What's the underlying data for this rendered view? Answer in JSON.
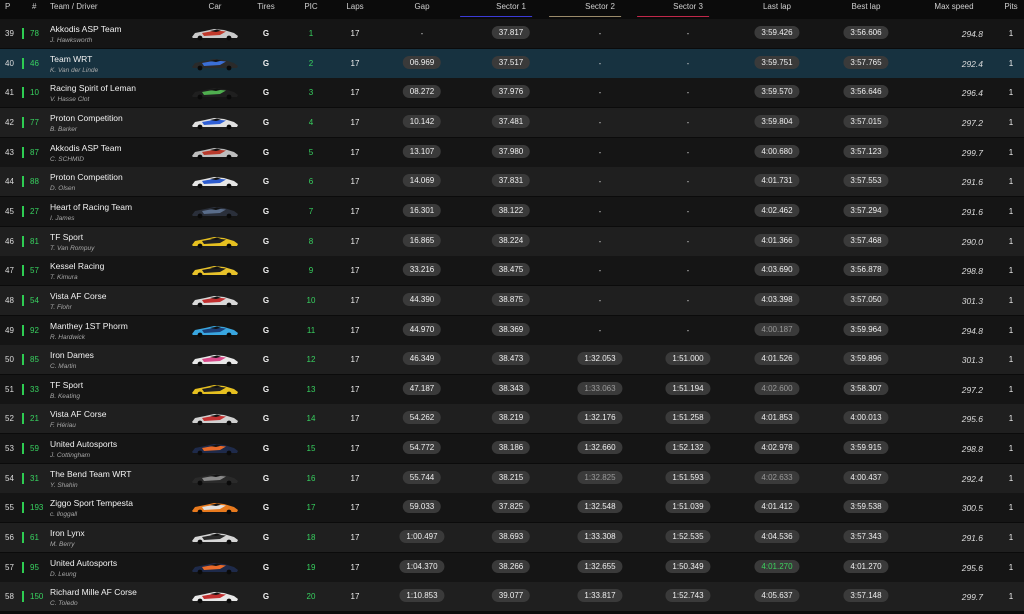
{
  "header": {
    "p": "P",
    "num": "#",
    "team_driver": "Team / Driver",
    "car": "Car",
    "tires": "Tires",
    "pic": "PIC",
    "laps": "Laps",
    "gap": "Gap",
    "sector1": "Sector 1",
    "sector2": "Sector 2",
    "sector3": "Sector 3",
    "last_lap": "Last lap",
    "best_lap": "Best lap",
    "max_speed": "Max speed",
    "pits": "Pits"
  },
  "colors": {
    "sector1": "#3b3bd6",
    "sector2": "#9a8a6a",
    "sector3": "#c0284a",
    "accent_green": "#38d260",
    "highlight_row": "#173240"
  },
  "rows": [
    {
      "p": "39",
      "num": "78",
      "team": "Akkodis ASP Team",
      "driver": "J. Hawksworth",
      "car_colors": [
        "#c9c9c9",
        "#c0392b"
      ],
      "tires": "G",
      "pic": "1",
      "laps": "17",
      "gap": "-",
      "s1": "37.817",
      "s2": "-",
      "s3": "-",
      "last": "3:59.426",
      "best": "3:56.606",
      "speed": "294.8",
      "pits": "1",
      "last_style": "",
      "s2_style": ""
    },
    {
      "p": "40",
      "num": "46",
      "team": "Team WRT",
      "driver": "K. Van der Linde",
      "car_colors": [
        "#2a2a2a",
        "#3b6fd6"
      ],
      "tires": "G",
      "pic": "2",
      "laps": "17",
      "gap": "06.969",
      "s1": "37.517",
      "s2": "-",
      "s3": "-",
      "last": "3:59.751",
      "best": "3:57.765",
      "speed": "292.4",
      "pits": "1",
      "last_style": "",
      "s2_style": ""
    },
    {
      "p": "41",
      "num": "10",
      "team": "Racing Spirit of Leman",
      "driver": "V. Hasse Clot",
      "car_colors": [
        "#1f1f1f",
        "#4fae4f"
      ],
      "tires": "G",
      "pic": "3",
      "laps": "17",
      "gap": "08.272",
      "s1": "37.976",
      "s2": "-",
      "s3": "-",
      "last": "3:59.570",
      "best": "3:56.646",
      "speed": "296.4",
      "pits": "1",
      "last_style": "",
      "s2_style": ""
    },
    {
      "p": "42",
      "num": "77",
      "team": "Proton Competition",
      "driver": "B. Barker",
      "car_colors": [
        "#e0e0e0",
        "#2f5fd6"
      ],
      "tires": "G",
      "pic": "4",
      "laps": "17",
      "gap": "10.142",
      "s1": "37.481",
      "s2": "-",
      "s3": "-",
      "last": "3:59.804",
      "best": "3:57.015",
      "speed": "297.2",
      "pits": "1",
      "last_style": "",
      "s2_style": ""
    },
    {
      "p": "43",
      "num": "87",
      "team": "Akkodis ASP Team",
      "driver": "C. SCHMID",
      "car_colors": [
        "#bdbdbd",
        "#b83a2c"
      ],
      "tires": "G",
      "pic": "5",
      "laps": "17",
      "gap": "13.107",
      "s1": "37.980",
      "s2": "-",
      "s3": "-",
      "last": "4:00.680",
      "best": "3:57.123",
      "speed": "299.7",
      "pits": "1",
      "last_style": "",
      "s2_style": ""
    },
    {
      "p": "44",
      "num": "88",
      "team": "Proton Competition",
      "driver": "D. Olsen",
      "car_colors": [
        "#e6e6e6",
        "#2d5ccf"
      ],
      "tires": "G",
      "pic": "6",
      "laps": "17",
      "gap": "14.069",
      "s1": "37.831",
      "s2": "-",
      "s3": "-",
      "last": "4:01.731",
      "best": "3:57.553",
      "speed": "291.6",
      "pits": "1",
      "last_style": "",
      "s2_style": ""
    },
    {
      "p": "45",
      "num": "27",
      "team": "Heart of Racing Team",
      "driver": "I. James",
      "car_colors": [
        "#2a2f3a",
        "#5a6d8a"
      ],
      "tires": "G",
      "pic": "7",
      "laps": "17",
      "gap": "16.301",
      "s1": "38.122",
      "s2": "-",
      "s3": "-",
      "last": "4:02.462",
      "best": "3:57.294",
      "speed": "291.6",
      "pits": "1",
      "last_style": "",
      "s2_style": ""
    },
    {
      "p": "46",
      "num": "81",
      "team": "TF Sport",
      "driver": "T. Van Rompuy",
      "car_colors": [
        "#e6c020",
        "#222222"
      ],
      "tires": "G",
      "pic": "8",
      "laps": "17",
      "gap": "16.865",
      "s1": "38.224",
      "s2": "-",
      "s3": "-",
      "last": "4:01.366",
      "best": "3:57.468",
      "speed": "290.0",
      "pits": "1",
      "last_style": "",
      "s2_style": ""
    },
    {
      "p": "47",
      "num": "57",
      "team": "Kessel Racing",
      "driver": "T. Kimura",
      "car_colors": [
        "#e8c22a",
        "#1e1e1e"
      ],
      "tires": "G",
      "pic": "9",
      "laps": "17",
      "gap": "33.216",
      "s1": "38.475",
      "s2": "-",
      "s3": "-",
      "last": "4:03.690",
      "best": "3:56.878",
      "speed": "298.8",
      "pits": "1",
      "last_style": "",
      "s2_style": ""
    },
    {
      "p": "48",
      "num": "54",
      "team": "Vista AF Corse",
      "driver": "T. Flohr",
      "car_colors": [
        "#d8d8d8",
        "#c23030"
      ],
      "tires": "G",
      "pic": "10",
      "laps": "17",
      "gap": "44.390",
      "s1": "38.875",
      "s2": "-",
      "s3": "-",
      "last": "4:03.398",
      "best": "3:57.050",
      "speed": "301.3",
      "pits": "1",
      "last_style": "",
      "s2_style": ""
    },
    {
      "p": "49",
      "num": "92",
      "team": "Manthey 1ST Phorm",
      "driver": "R. Hardwick",
      "car_colors": [
        "#39a6e0",
        "#1c3f77"
      ],
      "tires": "G",
      "pic": "11",
      "laps": "17",
      "gap": "44.970",
      "s1": "38.369",
      "s2": "-",
      "s3": "-",
      "last": "4:00.187",
      "best": "3:59.964",
      "speed": "294.8",
      "pits": "1",
      "last_style": "dim",
      "s2_style": ""
    },
    {
      "p": "50",
      "num": "85",
      "team": "Iron Dames",
      "driver": "C. Martin",
      "car_colors": [
        "#e8e8e8",
        "#d94a8a"
      ],
      "tires": "G",
      "pic": "12",
      "laps": "17",
      "gap": "46.349",
      "s1": "38.473",
      "s2": "1:32.053",
      "s3": "1:51.000",
      "last": "4:01.526",
      "best": "3:59.896",
      "speed": "301.3",
      "pits": "1",
      "last_style": "",
      "s2_style": ""
    },
    {
      "p": "51",
      "num": "33",
      "team": "TF Sport",
      "driver": "B. Keating",
      "car_colors": [
        "#e6c020",
        "#222222"
      ],
      "tires": "G",
      "pic": "13",
      "laps": "17",
      "gap": "47.187",
      "s1": "38.343",
      "s2": "1:33.063",
      "s3": "1:51.194",
      "last": "4:02.600",
      "best": "3:58.307",
      "speed": "297.2",
      "pits": "1",
      "last_style": "dim",
      "s2_style": "dim"
    },
    {
      "p": "52",
      "num": "21",
      "team": "Vista AF Corse",
      "driver": "F. Hériau",
      "car_colors": [
        "#d0d0d0",
        "#c43232"
      ],
      "tires": "G",
      "pic": "14",
      "laps": "17",
      "gap": "54.262",
      "s1": "38.219",
      "s2": "1:32.176",
      "s3": "1:51.258",
      "last": "4:01.853",
      "best": "4:00.013",
      "speed": "295.6",
      "pits": "1",
      "last_style": "",
      "s2_style": ""
    },
    {
      "p": "53",
      "num": "59",
      "team": "United Autosports",
      "driver": "J. Cottingham",
      "car_colors": [
        "#1e2a4a",
        "#e86a2a"
      ],
      "tires": "G",
      "pic": "15",
      "laps": "17",
      "gap": "54.772",
      "s1": "38.186",
      "s2": "1:32.660",
      "s3": "1:52.132",
      "last": "4:02.978",
      "best": "3:59.915",
      "speed": "298.8",
      "pits": "1",
      "last_style": "",
      "s2_style": ""
    },
    {
      "p": "54",
      "num": "31",
      "team": "The Bend Team WRT",
      "driver": "Y. Shahin",
      "car_colors": [
        "#2a2a2a",
        "#8a8a8a"
      ],
      "tires": "G",
      "pic": "16",
      "laps": "17",
      "gap": "55.744",
      "s1": "38.215",
      "s2": "1:32.825",
      "s3": "1:51.593",
      "last": "4:02.633",
      "best": "4:00.437",
      "speed": "292.4",
      "pits": "1",
      "last_style": "dim",
      "s2_style": "dim"
    },
    {
      "p": "55",
      "num": "193",
      "team": "Ziggo Sport Tempesta",
      "driver": "c. lloggall",
      "car_colors": [
        "#e87a1e",
        "#e0e0e0"
      ],
      "tires": "G",
      "pic": "17",
      "laps": "17",
      "gap": "59.033",
      "s1": "37.825",
      "s2": "1:32.548",
      "s3": "1:51.039",
      "last": "4:01.412",
      "best": "3:59.538",
      "speed": "300.5",
      "pits": "1",
      "last_style": "",
      "s2_style": ""
    },
    {
      "p": "56",
      "num": "61",
      "team": "Iron Lynx",
      "driver": "M. Berry",
      "car_colors": [
        "#d6d6d6",
        "#2a2a2a"
      ],
      "tires": "G",
      "pic": "18",
      "laps": "17",
      "gap": "1:00.497",
      "s1": "38.693",
      "s2": "1:33.308",
      "s3": "1:52.535",
      "last": "4:04.536",
      "best": "3:57.343",
      "speed": "291.6",
      "pits": "1",
      "last_style": "",
      "s2_style": ""
    },
    {
      "p": "57",
      "num": "95",
      "team": "United Autosports",
      "driver": "D. Leung",
      "car_colors": [
        "#1e2a4a",
        "#e86a2a"
      ],
      "tires": "G",
      "pic": "19",
      "laps": "17",
      "gap": "1:04.370",
      "s1": "38.266",
      "s2": "1:32.655",
      "s3": "1:50.349",
      "last": "4:01.270",
      "best": "4:01.270",
      "speed": "295.6",
      "pits": "1",
      "last_style": "green",
      "s2_style": ""
    },
    {
      "p": "58",
      "num": "150",
      "team": "Richard Mille AF Corse",
      "driver": "C. Toledo",
      "car_colors": [
        "#e8e8e8",
        "#c23030"
      ],
      "tires": "G",
      "pic": "20",
      "laps": "17",
      "gap": "1:10.853",
      "s1": "39.077",
      "s2": "1:33.817",
      "s3": "1:52.743",
      "last": "4:05.637",
      "best": "3:57.148",
      "speed": "299.7",
      "pits": "1",
      "last_style": "",
      "s2_style": ""
    }
  ]
}
